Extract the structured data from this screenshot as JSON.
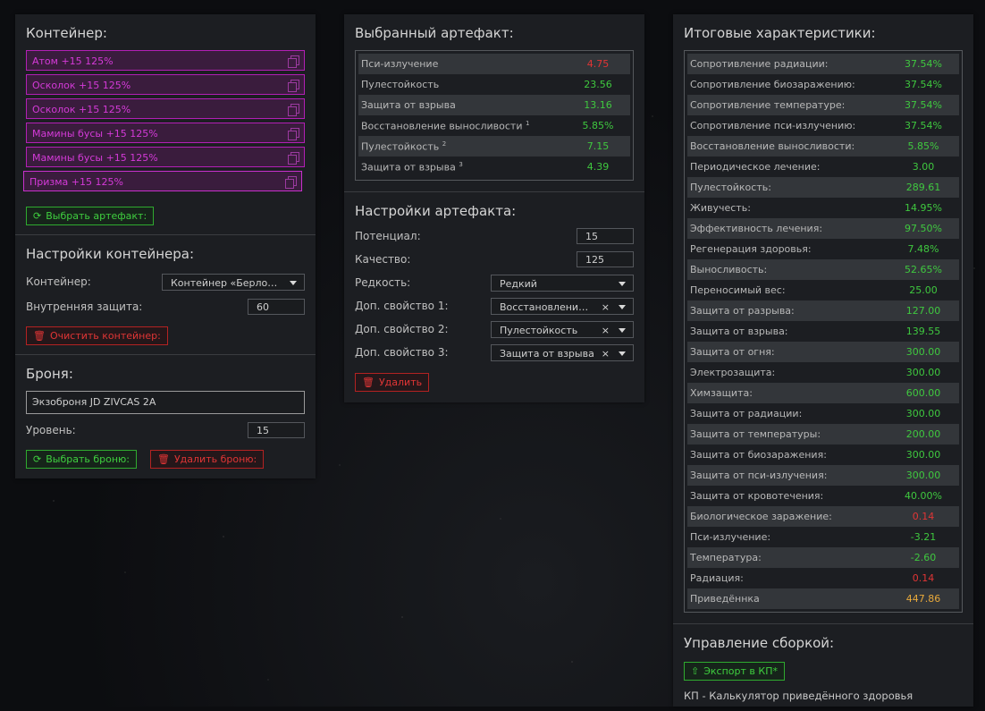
{
  "container_panel": {
    "title": "Контейнер:",
    "items": [
      {
        "label": "Атом +15 125%"
      },
      {
        "label": "Осколок +15 125%"
      },
      {
        "label": "Осколок +15 125%"
      },
      {
        "label": "Мамины бусы +15 125%"
      },
      {
        "label": "Мамины бусы +15 125%"
      },
      {
        "label": "Призма +15 125%"
      }
    ],
    "choose_button": "Выбрать артефакт:",
    "settings_title": "Настройки контейнера:",
    "container_label": "Контейнер:",
    "container_value": "Контейнер «Берлога...",
    "inner_protection_label": "Внутренняя защита:",
    "inner_protection_value": "60",
    "clear_button": "Очистить контейнер:",
    "armor_title": "Броня:",
    "armor_value": "Экзоброня JD ZIVCAS 2A",
    "level_label": "Уровень:",
    "level_value": "15",
    "choose_armor_button": "Выбрать броню:",
    "delete_armor_button": "Удалить броню:"
  },
  "artifact_panel": {
    "title": "Выбранный артефакт:",
    "stats": [
      {
        "name": "Пси-излучение",
        "sup": "",
        "value": "4.75",
        "tone": "neg"
      },
      {
        "name": "Пулестойкость",
        "sup": "",
        "value": "23.56",
        "tone": "pos"
      },
      {
        "name": "Защита от взрыва",
        "sup": "",
        "value": "13.16",
        "tone": "pos"
      },
      {
        "name": "Восстановление выносливости",
        "sup": "1",
        "value": "5.85%",
        "tone": "pos"
      },
      {
        "name": "Пулестойкость",
        "sup": "2",
        "value": "7.15",
        "tone": "pos"
      },
      {
        "name": "Защита от взрыва",
        "sup": "3",
        "value": "4.39",
        "tone": "pos"
      }
    ],
    "settings_title": "Настройки артефакта:",
    "potential_label": "Потенциал:",
    "potential_value": "15",
    "quality_label": "Качество:",
    "quality_value": "125",
    "rarity_label": "Редкость:",
    "rarity_value": "Редкий",
    "extra1_label": "Доп. свойство 1:",
    "extra1_value": "Восстановление в...",
    "extra2_label": "Доп. свойство 2:",
    "extra2_value": "Пулестойкость",
    "extra3_label": "Доп. свойство 3:",
    "extra3_value": "Защита от взрыва",
    "clear_glyph": "×",
    "delete_button": "Удалить"
  },
  "totals_panel": {
    "title": "Итоговые характеристики:",
    "stats": [
      {
        "name": "Сопротивление радиации:",
        "value": "37.54%",
        "tone": "pos"
      },
      {
        "name": "Сопротивление биозаражению:",
        "value": "37.54%",
        "tone": "pos"
      },
      {
        "name": "Сопротивление температуре:",
        "value": "37.54%",
        "tone": "pos"
      },
      {
        "name": "Сопротивление пси-излучению:",
        "value": "37.54%",
        "tone": "pos"
      },
      {
        "name": "Восстановление выносливости:",
        "value": "5.85%",
        "tone": "pos"
      },
      {
        "name": "Периодическое лечение:",
        "value": "3.00",
        "tone": "pos"
      },
      {
        "name": "Пулестойкость:",
        "value": "289.61",
        "tone": "pos"
      },
      {
        "name": "Живучесть:",
        "value": "14.95%",
        "tone": "pos"
      },
      {
        "name": "Эффективность лечения:",
        "value": "97.50%",
        "tone": "pos"
      },
      {
        "name": "Регенерация здоровья:",
        "value": "7.48%",
        "tone": "pos"
      },
      {
        "name": "Выносливость:",
        "value": "52.65%",
        "tone": "pos"
      },
      {
        "name": "Переносимый вес:",
        "value": "25.00",
        "tone": "pos"
      },
      {
        "name": "Защита от разрыва:",
        "value": "127.00",
        "tone": "pos"
      },
      {
        "name": "Защита от взрыва:",
        "value": "139.55",
        "tone": "pos"
      },
      {
        "name": "Защита от огня:",
        "value": "300.00",
        "tone": "pos"
      },
      {
        "name": "Электрозащита:",
        "value": "300.00",
        "tone": "pos"
      },
      {
        "name": "Химзащита:",
        "value": "600.00",
        "tone": "pos"
      },
      {
        "name": "Защита от радиации:",
        "value": "300.00",
        "tone": "pos"
      },
      {
        "name": "Защита от температуры:",
        "value": "200.00",
        "tone": "pos"
      },
      {
        "name": "Защита от биозаражения:",
        "value": "300.00",
        "tone": "pos"
      },
      {
        "name": "Защита от пси-излучения:",
        "value": "300.00",
        "tone": "pos"
      },
      {
        "name": "Защита от кровотечения:",
        "value": "40.00%",
        "tone": "pos"
      },
      {
        "name": "Биологическое заражение:",
        "value": "0.14",
        "tone": "neg"
      },
      {
        "name": "Пси-излучение:",
        "value": "-3.21",
        "tone": "pos"
      },
      {
        "name": "Температура:",
        "value": "-2.60",
        "tone": "pos"
      },
      {
        "name": "Радиация:",
        "value": "0.14",
        "tone": "neg"
      },
      {
        "name": "Приведённка",
        "value": "447.86",
        "tone": "gold"
      }
    ],
    "manage_title": "Управление сборкой:",
    "export_button": "Экспорт в КП*",
    "footnote": "КП - Калькулятор приведённого здоровья"
  }
}
